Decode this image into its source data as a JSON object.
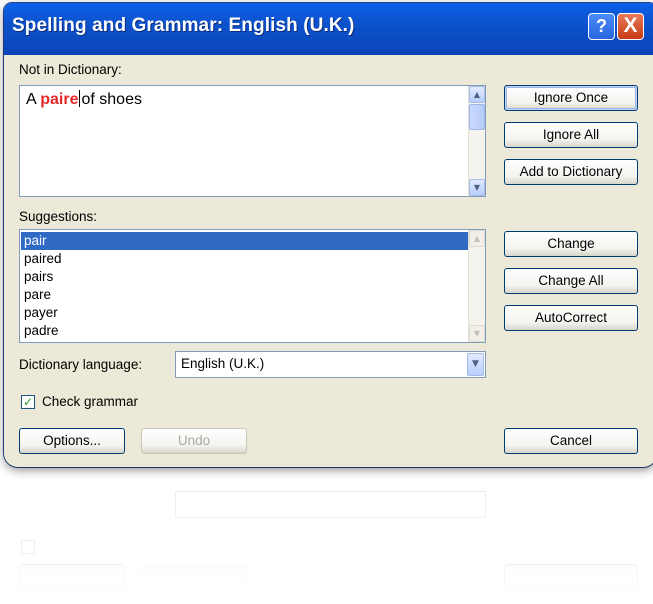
{
  "dialog": {
    "title": "Spelling and Grammar: English (U.K.)",
    "help_glyph": "?",
    "close_glyph": "X"
  },
  "not_in_dictionary": {
    "label": "Not in Dictionary:",
    "text_before": "A ",
    "error_word": "paire",
    "text_after": "of shoes",
    "error_color": "#e62a2a"
  },
  "suggestions": {
    "label": "Suggestions:",
    "items": [
      "pair",
      "paired",
      "pairs",
      "pare",
      "payer",
      "padre"
    ],
    "selected_index": 0
  },
  "dictionary_language": {
    "label": "Dictionary language:",
    "value": "English (U.K.)"
  },
  "check_grammar": {
    "label": "Check grammar",
    "checked": true
  },
  "buttons": {
    "ignore_once": "Ignore Once",
    "ignore_all": "Ignore All",
    "add_to_dictionary": "Add to Dictionary",
    "change": "Change",
    "change_all": "Change All",
    "autocorrect": "AutoCorrect",
    "options": "Options...",
    "undo": "Undo",
    "cancel": "Cancel"
  },
  "colors": {
    "titlebar": "#0b4ec6",
    "selection": "#316ac5",
    "dialog_face": "#ece9d8"
  }
}
